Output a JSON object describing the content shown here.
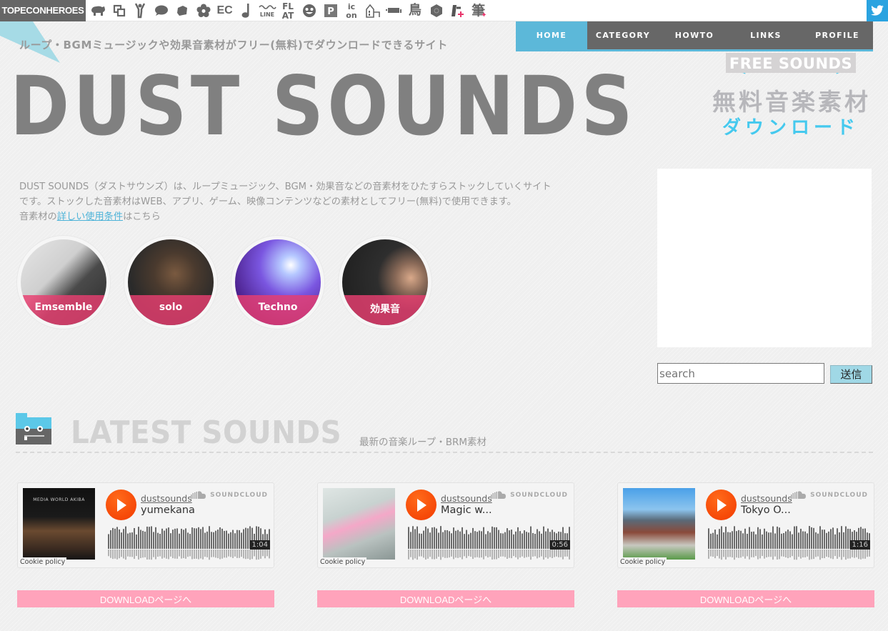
{
  "topbar": {
    "brand": "TOPECONHEROES",
    "site_icons": [
      {
        "name": "hippo-icon",
        "glyph": "🦛"
      },
      {
        "name": "windows-icon",
        "glyph": "⧉"
      },
      {
        "name": "dancer-icon",
        "glyph": "Y"
      },
      {
        "name": "speech-bubble-icon",
        "glyph": "●"
      },
      {
        "name": "tag-icon",
        "glyph": "◆"
      },
      {
        "name": "flower-icon",
        "glyph": "✿"
      },
      {
        "name": "ec-icon",
        "glyph": "EC"
      },
      {
        "name": "music-note-icon",
        "glyph": "♩"
      },
      {
        "name": "line-icon",
        "glyph": "〰 LINE"
      },
      {
        "name": "flat-icon",
        "glyph": "FL AT"
      },
      {
        "name": "smiley-icon",
        "glyph": "☻"
      },
      {
        "name": "parking-icon",
        "glyph": "P"
      },
      {
        "name": "icon-icon",
        "glyph": "ic on"
      },
      {
        "name": "building-icon",
        "glyph": "⌂"
      },
      {
        "name": "bench-icon",
        "glyph": "▬"
      },
      {
        "name": "bird-kanji-icon",
        "glyph": "鳥"
      },
      {
        "name": "hexagon-icon",
        "glyph": "⬢"
      },
      {
        "name": "do-icon",
        "glyph": "ド"
      },
      {
        "name": "brush-kanji-icon",
        "glyph": "筆"
      }
    ],
    "twitter_icon": "twitter-icon"
  },
  "header": {
    "tagline": "ループ・BGMミュージックや効果音素材がフリー(無料)でダウンロードできるサイト",
    "logo": "DUST SOUNDS",
    "badge": {
      "ribbon": "FREE SOUNDS",
      "title": "無料音楽素材",
      "subtitle": "ダウンロード"
    }
  },
  "nav": {
    "items": [
      {
        "label": "HOME",
        "active": true
      },
      {
        "label": "CATEGORY",
        "active": false
      },
      {
        "label": "HOWTO",
        "active": false
      },
      {
        "label": "LINKS",
        "active": false
      },
      {
        "label": "PROFILE",
        "active": false
      }
    ]
  },
  "intro": {
    "line1": "DUST SOUNDS（ダストサウンズ）は、ループミュージック、BGM・効果音などの音素材をひたすらストックしていくサイト",
    "line2": "です。ストックした音素材はWEB、アプリ、ゲーム、映像コンテンツなどの素材としてフリー(無料)で使用できます。",
    "line3_prefix": "音素材の",
    "line3_link": "詳しい使用条件",
    "line3_suffix": "はこちら"
  },
  "categories": [
    {
      "label": "Emsemble"
    },
    {
      "label": "solo"
    },
    {
      "label": "Techno"
    },
    {
      "label": "効果音"
    }
  ],
  "sidebar": {
    "search_placeholder": "search",
    "search_value": "",
    "submit_label": "送信"
  },
  "latest": {
    "title": "LATEST SOUNDS",
    "subtitle": "最新の音楽ループ・BRM素材",
    "tracks": [
      {
        "user": "dustsounds",
        "title": "yumekana",
        "duration": "1:04",
        "artwork_caption": "MEDIA WORLD AKIBA",
        "cookie": "Cookie policy",
        "provider": "SOUNDCLOUD",
        "download_label": "DOWNLOADページへ"
      },
      {
        "user": "dustsounds",
        "title": "Magic w...",
        "duration": "0:56",
        "artwork_caption": "",
        "cookie": "Cookie policy",
        "provider": "SOUNDCLOUD",
        "download_label": "DOWNLOADページへ"
      },
      {
        "user": "dustsounds",
        "title": "Tokyo O...",
        "duration": "1:16",
        "artwork_caption": "",
        "cookie": "Cookie policy",
        "provider": "SOUNDCLOUD",
        "download_label": "DOWNLOADページへ"
      }
    ]
  },
  "colors": {
    "accent_blue": "#5cb8d9",
    "nav_gray": "#676767",
    "category_pink": "#e83e70",
    "download_pink": "#ffa3bb",
    "soundcloud_orange": "#f23a00",
    "badge_cyan": "#45c9ee"
  }
}
